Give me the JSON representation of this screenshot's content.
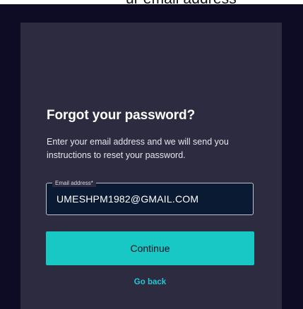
{
  "top_fragment": "ur email address",
  "form": {
    "title": "Forgot your password?",
    "description": "Enter your email address and we will send you instructions to reset your password.",
    "email": {
      "label": "Email address*",
      "value": "UMESHPM1982@GMAIL.COM"
    },
    "continue_label": "Continue",
    "go_back_label": "Go back"
  },
  "colors": {
    "backdrop": "#0d0c24",
    "card": "#2c2b3f",
    "input_background": "#0b1a33",
    "button": "#17c8c4",
    "link": "#26c6d6"
  }
}
